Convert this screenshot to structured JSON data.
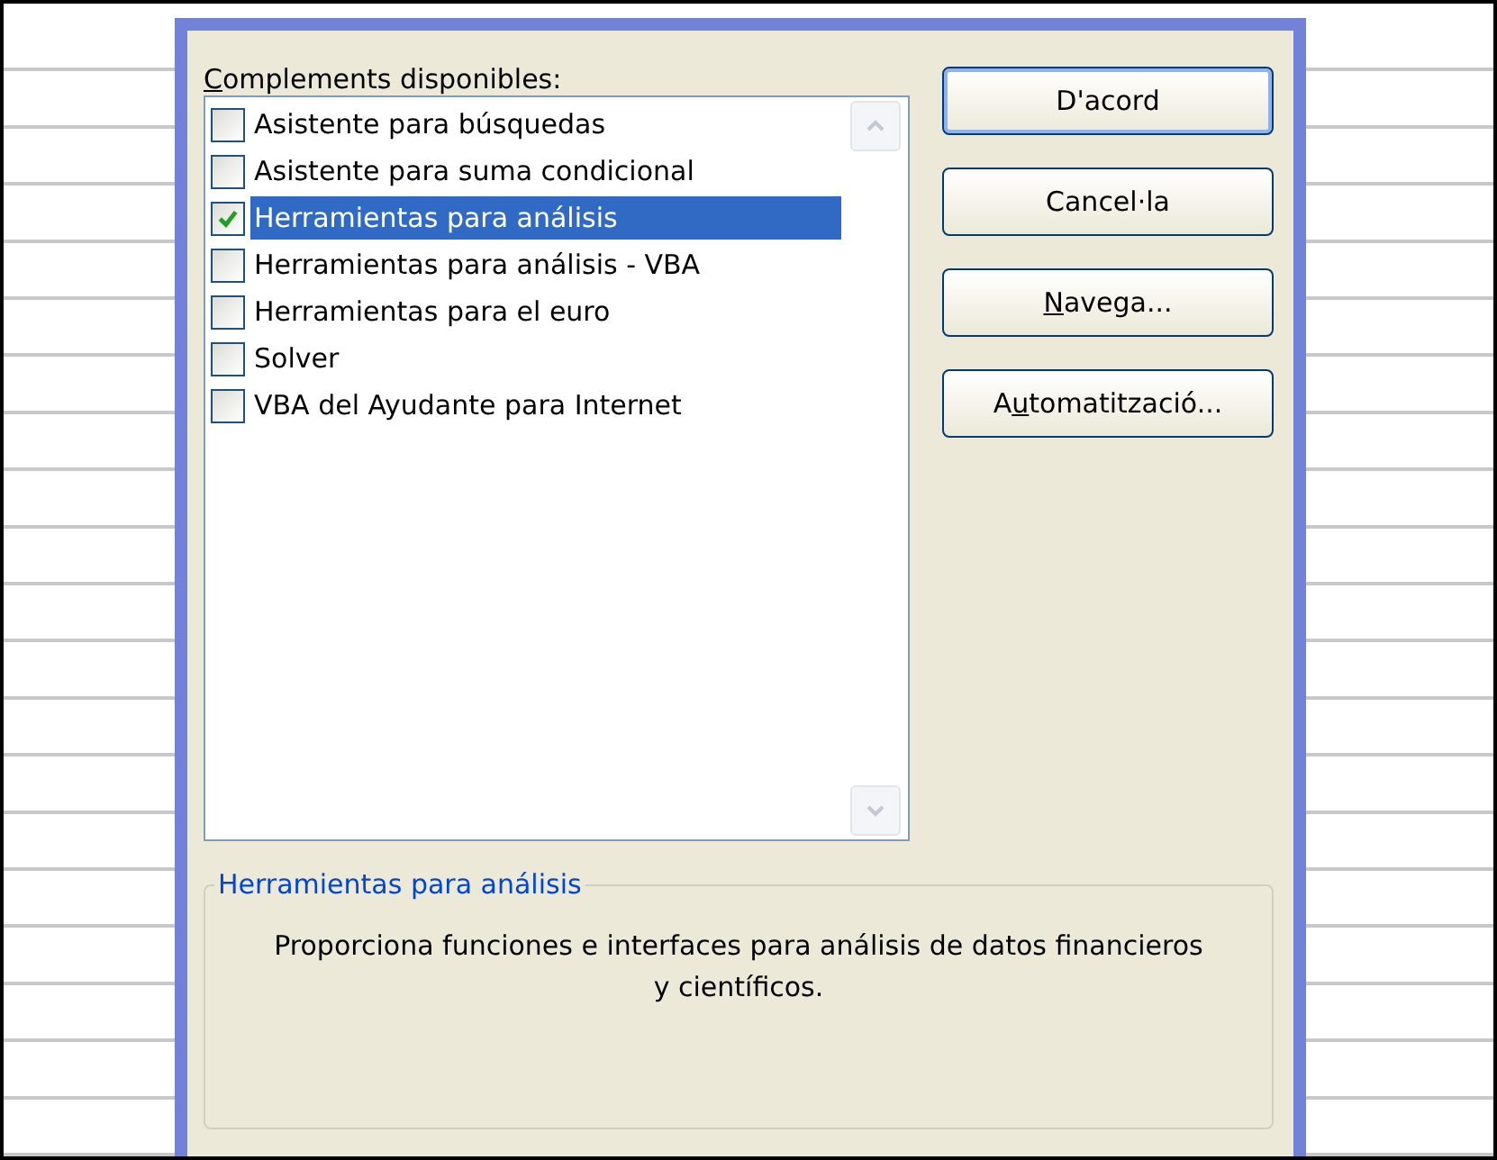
{
  "dialog": {
    "list_label": {
      "key": "C",
      "post": "omplements disponibles:"
    },
    "addins": [
      {
        "label": "Asistente para búsquedas",
        "checked": false,
        "selected": false
      },
      {
        "label": "Asistente para suma condicional",
        "checked": false,
        "selected": false
      },
      {
        "label": "Herramientas para análisis",
        "checked": true,
        "selected": true
      },
      {
        "label": "Herramientas para análisis - VBA",
        "checked": false,
        "selected": false
      },
      {
        "label": "Herramientas para el euro",
        "checked": false,
        "selected": false
      },
      {
        "label": "Solver",
        "checked": false,
        "selected": false
      },
      {
        "label": "VBA del Ayudante para Internet",
        "checked": false,
        "selected": false
      }
    ],
    "buttons": [
      {
        "pre": "D'acord",
        "default": true
      },
      {
        "pre": "Cancel·la",
        "default": false
      },
      {
        "key": "N",
        "post": "avega...",
        "default": false
      },
      {
        "pre": "A",
        "key": "u",
        "post": "tomatització...",
        "default": false
      }
    ],
    "description": {
      "title": "Herramientas para análisis",
      "text": "Proporciona funciones e interfaces para análisis de datos financieros y científicos."
    }
  }
}
